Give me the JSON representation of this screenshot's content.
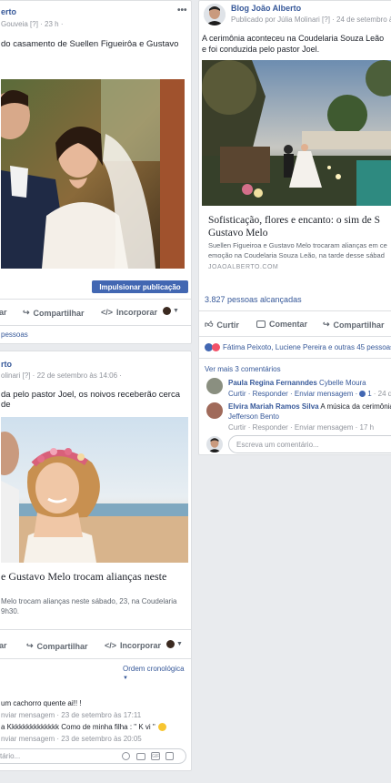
{
  "left_top": {
    "author": "erto",
    "meta": "Gouveia [?] · 23 h ·",
    "text": "do casamento de Suellen Figueirôa e Gustavo",
    "boost_label": "Impulsionar publicação",
    "actions": {
      "like": "ar",
      "share": "Compartilhar",
      "embed": "Incorporar"
    },
    "reach": "pessoas"
  },
  "left_bottom": {
    "author": "rto",
    "meta": "olinari [?] · 22 de setembro às 14:06 ·",
    "text": "da pelo pastor Joel, os noivos receberão cerca de",
    "link_title": "e Gustavo Melo trocam alianças neste",
    "link_desc_1": "Melo trocam alianças neste sábado, 23, na Coudelaria",
    "link_desc_2": "9h30.",
    "actions": {
      "like": "ar",
      "share": "Compartilhar",
      "embed": "Incorporar"
    },
    "order_label": "Ordem cronológica",
    "comments": [
      {
        "text": "um cachorro quente ai!! !",
        "meta": "nviar mensagem · 23 de setembro às 17:11"
      },
      {
        "text": "a Kkkkkkkkkkkkkk Como de minha filha : \" K vi \"",
        "meta": "nviar mensagem · 23 de setembro às 20:05"
      }
    ],
    "comment_placeholder": "tário..."
  },
  "right": {
    "author": "Blog João Alberto",
    "meta": "Publicado por Júlia Molinari [?] · 24 de setembro às",
    "text_1": "A cerimônia aconteceu na Coudelaria Souza Leão",
    "text_2": "e foi conduzida pelo pastor Joel.",
    "link_title_1": "Sofisticação, flores e encanto: o sim de S",
    "link_title_2": "Gustavo Melo",
    "link_desc_1": "Suellen Figueiroa e Gustavo Melo trocaram alianças em ce",
    "link_desc_2": "emoção na Coudelaria Souza Leão, na tarde desse sábad",
    "link_domain": "JOAOALBERTO.COM",
    "reach": "3.827 pessoas alcançadas",
    "actions": {
      "like": "Curtir",
      "comment": "Comentar",
      "share": "Compartilhar"
    },
    "reactions": "Fátima Peixoto, Luciene Pereira e outras 45 pessoas",
    "more_comments": "Ver mais 3 comentários",
    "comments": [
      {
        "name": "Paula Regina Fernanndes",
        "text": "Cybelle Moura",
        "actions": "Curtir · Responder · Enviar mensagem ·",
        "likes": "1",
        "time": "· 24 d"
      },
      {
        "name": "Elvira Mariah Ramos Silva",
        "text": "A música da cerimônia",
        "text2": "Jefferson Bento",
        "actions": "Curtir · Responder · Enviar mensagem · 17 h"
      }
    ],
    "comment_placeholder": "Escreva um comentário..."
  }
}
